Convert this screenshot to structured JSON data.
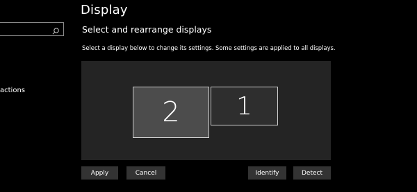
{
  "sidebar": {
    "search": {
      "value": "",
      "placeholder": ""
    },
    "partial_item_label": "actions"
  },
  "main": {
    "page_title": "Display",
    "section_title": "Select and rearrange displays",
    "instruction": "Select a display below to change its settings. Some settings are applied to all displays.",
    "displays": [
      {
        "number": "2",
        "selected": true
      },
      {
        "number": "1",
        "selected": false
      }
    ]
  },
  "buttons": {
    "apply": "Apply",
    "cancel": "Cancel",
    "identify": "Identify",
    "detect": "Detect"
  },
  "icons": {
    "search": "search-icon"
  },
  "colors": {
    "background": "#000000",
    "display_area": "#242424",
    "selected_monitor": "#4c4c4c",
    "monitor": "#2e2e2e",
    "button": "#333333"
  }
}
